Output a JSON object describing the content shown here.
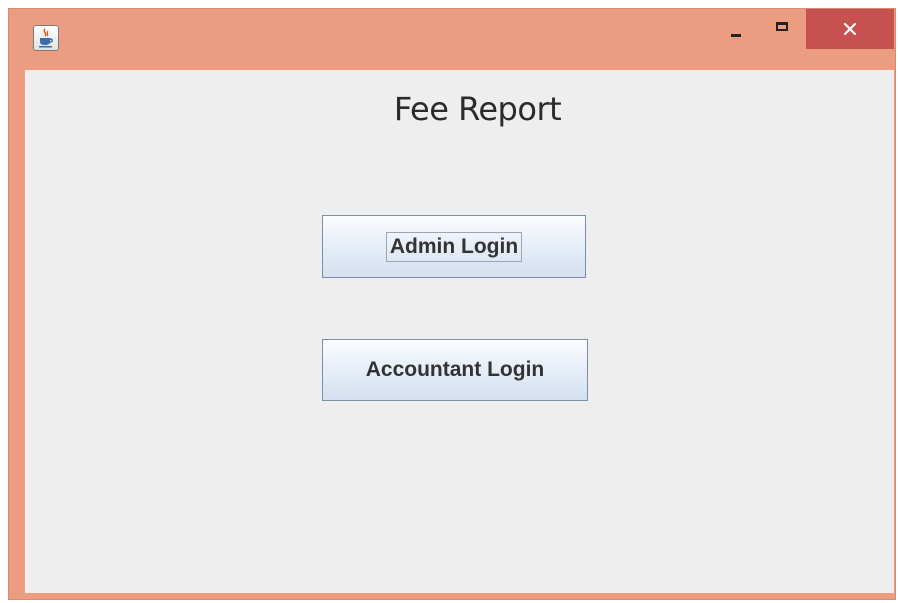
{
  "window": {
    "title": "",
    "icons": {
      "app": "java-cup-icon",
      "minimize": "minimize-icon",
      "maximize": "maximize-icon",
      "close": "close-icon"
    },
    "colors": {
      "frame": "#ec9c80",
      "close_button": "#c75050",
      "client": "#eeeeee"
    }
  },
  "main": {
    "title": "Fee Report",
    "buttons": {
      "admin_login": "Admin Login",
      "accountant_login": "Accountant Login"
    }
  }
}
